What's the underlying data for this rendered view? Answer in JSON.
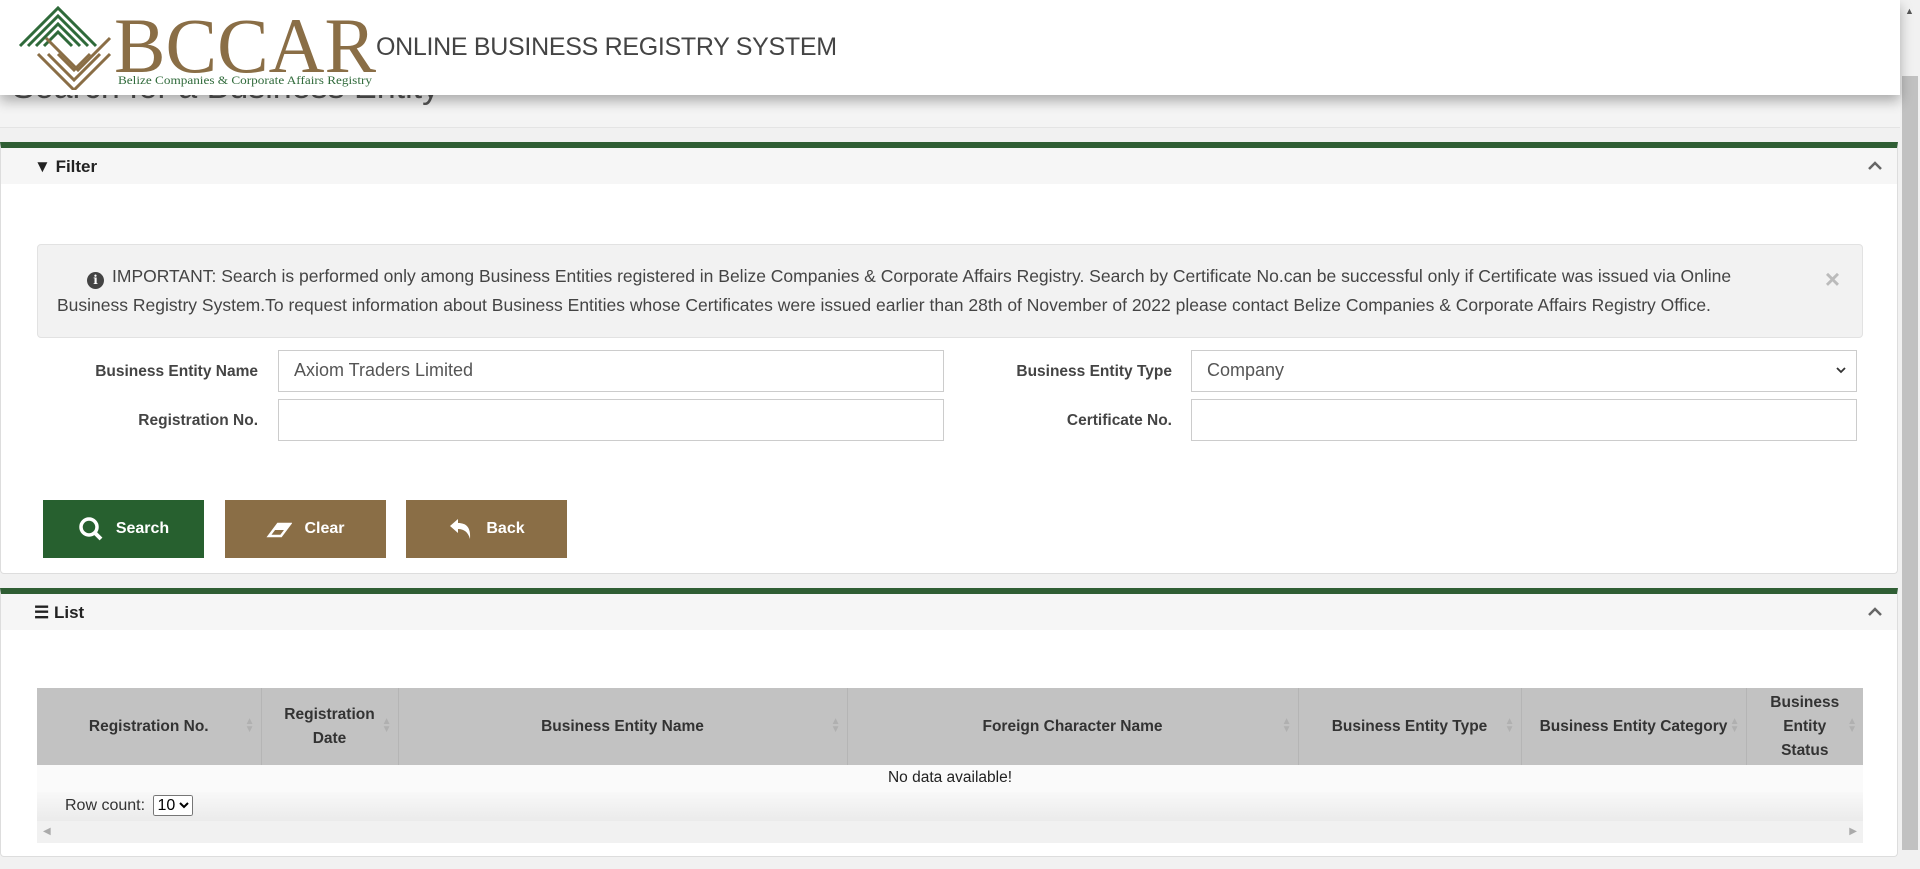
{
  "header": {
    "logo_text": "BCCAR",
    "logo_subtitle": "Belize Companies & Corporate Affairs Registry",
    "system_title": "ONLINE BUSINESS REGISTRY SYSTEM"
  },
  "page": {
    "title": "Search for a Business Entity"
  },
  "filter": {
    "title": "Filter",
    "alert": "IMPORTANT: Search is performed only among Business Entities registered in Belize Companies & Corporate Affairs Registry. Search by Certificate No.can be successful only if Certificate was issued via Online Business Registry System.To request information about Business Entities whose Certificates were issued earlier than 28th of November of 2022 please contact Belize Companies & Corporate Affairs Registry Office.",
    "fields": {
      "entity_name": {
        "label": "Business Entity Name",
        "value": "Axiom Traders Limited"
      },
      "entity_type": {
        "label": "Business Entity Type",
        "value": "Company"
      },
      "registration_no": {
        "label": "Registration No.",
        "value": ""
      },
      "certificate_no": {
        "label": "Certificate No.",
        "value": ""
      }
    },
    "buttons": {
      "search": "Search",
      "clear": "Clear",
      "back": "Back"
    }
  },
  "list": {
    "title": "List",
    "columns": [
      "Registration No.",
      "Registration Date",
      "Business Entity Name",
      "Foreign Character Name",
      "Business Entity Type",
      "Business Entity Category",
      "Business Entity Status"
    ],
    "empty_message": "No data available!",
    "row_count_label": "Row count:",
    "row_count_value": "10"
  },
  "colors": {
    "primary_green": "#27602f",
    "brown": "#8a6e46"
  }
}
